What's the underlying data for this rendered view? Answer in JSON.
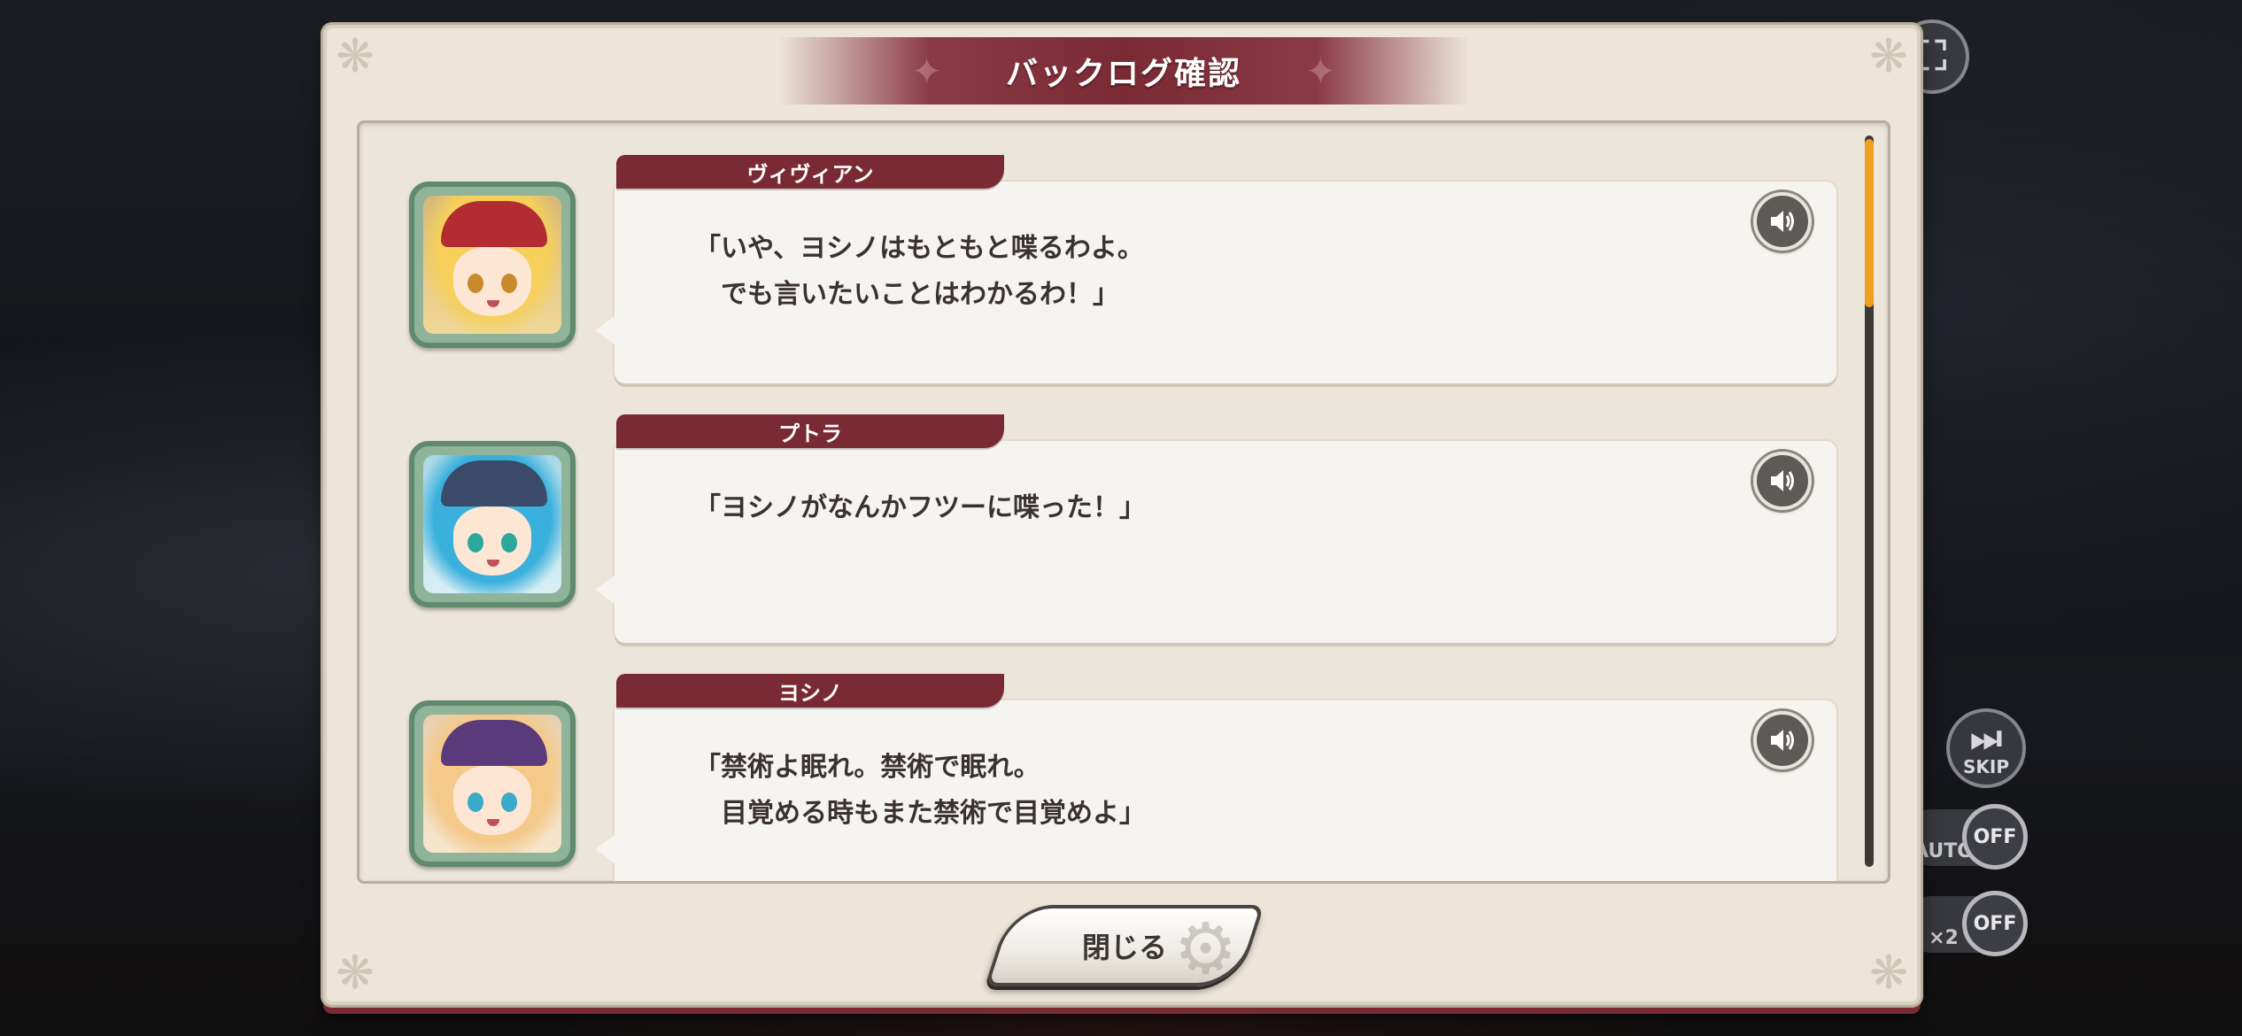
{
  "dialog": {
    "title": "バックログ確認",
    "close_label": "閉じる"
  },
  "entries": [
    {
      "speaker": "ヴィヴィアン",
      "text": "「いや、ヨシノはもともと喋るわよ。\n　でも言いたいことはわかるわ！」",
      "avatar_colors": {
        "hair": "#f6d05a",
        "hat": "#b22c32",
        "eyes": "#c88a2c"
      }
    },
    {
      "speaker": "プトラ",
      "text": "「ヨシノがなんかフツーに喋った！」",
      "avatar_colors": {
        "hair": "#3ab0dc",
        "hat": "#3c4a6a",
        "eyes": "#2aa89a"
      }
    },
    {
      "speaker": "ヨシノ",
      "text": "「禁術よ眠れ。禁術で眠れ。\n　目覚める時もまた禁術で目覚めよ」",
      "avatar_colors": {
        "hair": "#f4c98a",
        "hat": "#5a3a7a",
        "eyes": "#3aaac8"
      }
    }
  ],
  "scroll": {
    "position_fraction": 0.0
  },
  "background_controls": {
    "skip_label": "SKIP",
    "auto_label": "AUTO",
    "auto_state": "OFF",
    "speed_label": "×2",
    "speed_state": "OFF"
  },
  "colors": {
    "accent": "#7a2a33",
    "panel": "#ece5d8",
    "scroll_thumb": "#f0a020",
    "avatar_frame": "#8fb49a"
  },
  "icons": {
    "voice": "speaker-icon",
    "fullscreen": "fullscreen-icon",
    "close_decor": "gear-icon",
    "skip": "skip-icon",
    "auto": "play-icon",
    "speed": "fast-forward-icon"
  }
}
